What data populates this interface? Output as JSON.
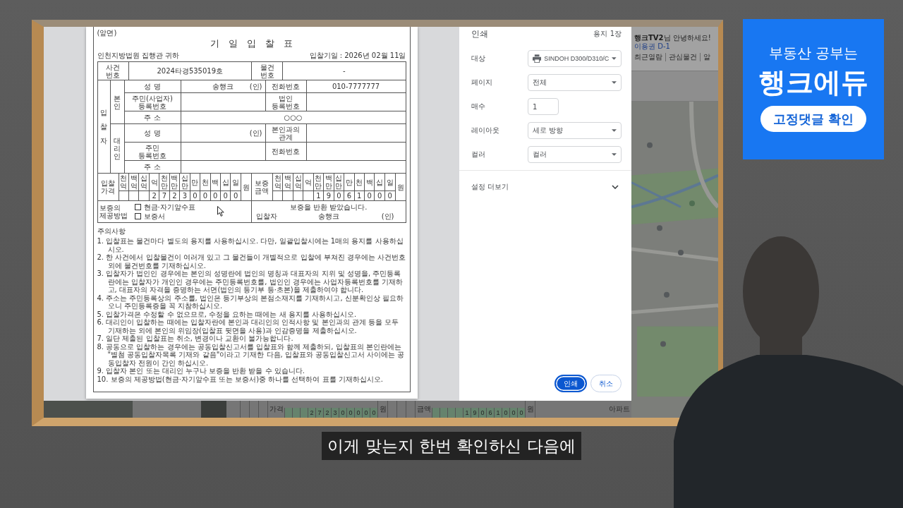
{
  "screen": {
    "print_preview": {
      "document": {
        "side_label": "(앞면)",
        "title": "기 일 입 찰 표",
        "court": "인천지방법원 집행관 귀하",
        "bid_date": "입찰기일 : 2026년 02월 11일",
        "case_row": {
          "case_label": "사건 번호",
          "case_no": "2024타경535019호",
          "item_label": "물건 번호",
          "item_no": "-"
        },
        "bidder": {
          "label": "입찰자",
          "principal": {
            "label": "본인",
            "name_label": "성 명",
            "name": "송행크",
            "seal": "(인)",
            "phone_label": "전화번호",
            "phone": "010-7777777",
            "id_label": "주민(사업자) 등록번호",
            "corp_id_label": "법인 등록번호",
            "address_label": "주 소",
            "address": "○○○"
          },
          "agent": {
            "label": "대리인",
            "name_label": "성 명",
            "seal": "(인)",
            "relation_label": "본인과의 관계",
            "id_label": "주민 등록번호",
            "phone_label": "전화번호",
            "address_label": "주 소"
          }
        },
        "amounts": [
          {
            "label": "입찰 가격",
            "units": [
              "천억",
              "백억",
              "십억",
              "억",
              "천만",
              "백만",
              "십만",
              "만",
              "천",
              "백",
              "십",
              "일"
            ],
            "digits": [
              "2",
              "7",
              "2",
              "3",
              "0",
              "0",
              "0",
              "0",
              "0"
            ],
            "currency": "원"
          },
          {
            "label": "보증 금액",
            "units": [
              "천억",
              "백억",
              "십억",
              "억",
              "천만",
              "백만",
              "십만",
              "만",
              "천",
              "백",
              "십",
              "일"
            ],
            "digits": [
              "1",
              "9",
              "0",
              "6",
              "1",
              "0",
              "0",
              "0"
            ],
            "currency": "원"
          }
        ],
        "deposit_method": {
          "label": "보증의 제공방법",
          "options": [
            {
              "label": "현금·자기앞수표",
              "checked": false
            },
            {
              "label": "보증서",
              "checked": false
            }
          ]
        },
        "receipt": {
          "text": "보증을 반환 받았습니다.",
          "bidder_label": "입찰자",
          "bidder": "송행크",
          "seal": "(인)"
        },
        "notes": {
          "heading": "주의사항",
          "items": [
            {
              "number": "1.",
              "text": "입찰표는 물건마다 별도의 용지를 사용하십시오. 다만, 일괄입찰시에는 1매의 용지를 사용하십시오."
            },
            {
              "number": "2.",
              "text": "한 사건에서 입찰물건이 여러개 있고 그 물건들이 개별적으로 입찰에 부쳐진 경우에는 사건번호외에 물건번호를 기재하십시오."
            },
            {
              "number": "3.",
              "text": "입찰자가 법인인 경우에는 본인의 성명란에 법인의 명칭과 대표자의 지위 및 성명을, 주민등록란에는 입찰자가 개인인 경우에는 주민등록번호를, 법인인 경우에는 사업자등록번호를 기재하고, 대표자의 자격을 증명하는 서면(법인의 등기부 등·초본)을 제출하여야 합니다."
            },
            {
              "number": "4.",
              "text": "주소는 주민등록상의 주소를, 법인은 등기부상의 본점소재지를 기재하시고, 신분확인상 필요하오니 주민등록증을 꼭 지참하십시오."
            },
            {
              "number": "5.",
              "text": "입찰가격은 수정할 수 없으므로, 수정을 요하는 때에는 새 용지를 사용하십시오."
            },
            {
              "number": "6.",
              "text": "대리인이 입찰하는 때에는 입찰자란에 본인과 대리인의 인적사항 및 본인과의 관계 등을 모두 기재하는 외에 본인의 위임장(입찰표 뒷면을 사용)과 인감증명을 제출하십시오."
            },
            {
              "number": "7.",
              "text": "일단 제출된 입찰표는 취소, 변경이나 교환이 불가능합니다."
            },
            {
              "number": "8.",
              "text": "공동으로 입찰하는 경우에는 공동입찰신고서를 입찰표와 함께 제출하되, 입찰표의 본인란에는 \"별첨 공동입찰자목록 기재와 같음\"이라고 기재한 다음, 입찰표와 공동입찰신고서 사이에는 공동입찰자 전원이 간인 하십시오."
            },
            {
              "number": "9.",
              "text": "입찰자 본인 또는 대리인 누구나 보증을 반환 받을 수 있습니다."
            },
            {
              "number": "10.",
              "text": "보증의 제공방법(현금·자기앞수표 또는 보증서)중 하나를 선택하여 표를 기재하십시오."
            }
          ]
        }
      }
    },
    "print_dialog": {
      "title": "인쇄",
      "sheet_count": "용지 1장",
      "settings": [
        {
          "kind": "printer",
          "label": "대상",
          "value": "SINDOH D300/D310/C"
        },
        {
          "kind": "select",
          "label": "페이지",
          "value": "전체"
        },
        {
          "kind": "number",
          "label": "매수",
          "value": "1"
        },
        {
          "kind": "select",
          "label": "레이아웃",
          "value": "세로 방향"
        },
        {
          "kind": "select",
          "label": "컬러",
          "value": "컬러"
        }
      ],
      "more_settings": {
        "label": "설정 더보기",
        "expanded": false
      },
      "buttons": [
        {
          "label": "인쇄",
          "kind": "primary",
          "focused": true
        },
        {
          "label": "취소",
          "kind": "secondary",
          "focused": false
        }
      ]
    },
    "background_site": {
      "greeting": "**행크TV2**님 안녕하세요!",
      "pass": "이용권 D-1",
      "nav": [
        "최근열람",
        "관심물건",
        "알"
      ],
      "strip": {
        "amounts": [
          {
            "label": "가격",
            "digits": [
              "2",
              "7",
              "2",
              "3",
              "0",
              "0",
              "0",
              "0",
              "0"
            ],
            "currency": "원"
          },
          {
            "label": "금액",
            "digits": [
              "1",
              "9",
              "0",
              "6",
              "1",
              "0",
              "0",
              "0"
            ],
            "currency": "원"
          }
        ],
        "map_label": "아파트"
      }
    }
  },
  "banner": {
    "tagline": "부동산 공부는",
    "brand": "행크에듀",
    "button": "고정댓글 확인"
  },
  "subtitle": "이게 맞는지 한번 확인하신 다음에"
}
